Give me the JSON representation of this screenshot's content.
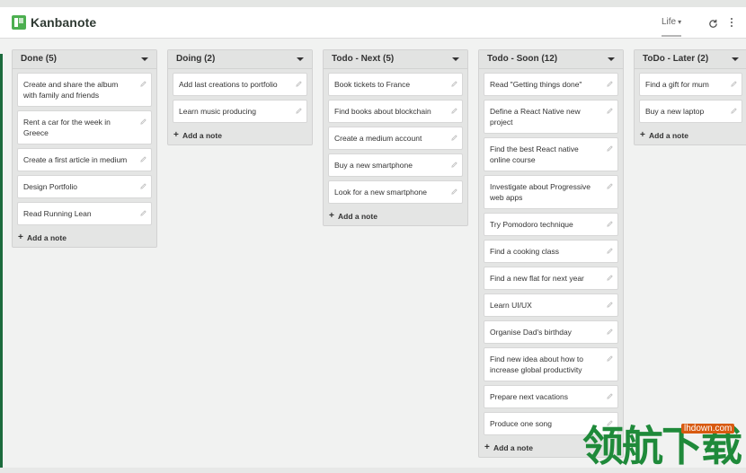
{
  "app": {
    "name": "Kanbanote"
  },
  "header": {
    "board_selector": "Life",
    "caret": "▾"
  },
  "icons": {
    "logo": "kanbanote-logo-icon",
    "refresh": "refresh-icon",
    "menu": "more-vertical-icon",
    "edit": "pencil-icon",
    "add": "plus-icon"
  },
  "colors": {
    "brand": "#1c6b3d",
    "logo_green": "#4caf50",
    "column_bg": "#e4e5e4",
    "card_bg": "#ffffff",
    "background": "#f1f2f1"
  },
  "add_note_label": "Add a note",
  "add_note_plus": "+",
  "columns": [
    {
      "title": "Done (5)",
      "cards": [
        "Create and share the album with family and friends",
        "Rent a car for the week in Greece",
        "Create a first article in medium",
        "Design Portfolio",
        "Read Running Lean"
      ]
    },
    {
      "title": "Doing (2)",
      "cards": [
        "Add last creations to portfolio",
        "Learn music producing"
      ]
    },
    {
      "title": "Todo - Next (5)",
      "cards": [
        "Book tickets to France",
        "Find books about blockchain",
        "Create a medium account",
        "Buy a new smartphone",
        "Look for a new smartphone"
      ]
    },
    {
      "title": "Todo - Soon (12)",
      "cards": [
        "Read \"Getting things done\"",
        "Define a React Native new project",
        "Find the best React native online course",
        "Investigate about Progressive web apps",
        "Try Pomodoro technique",
        "Find a cooking class",
        "Find a new flat for next year",
        "Learn UI/UX",
        "Organise Dad's birthday",
        "Find new idea about how to increase global productivity",
        "Prepare next vacations",
        "Produce one song"
      ]
    },
    {
      "title": "ToDo - Later (2)",
      "cards": [
        "Find a gift for mum",
        "Buy a new laptop"
      ]
    }
  ],
  "watermark": {
    "text": "领航下载",
    "url": "lhdown.com"
  }
}
